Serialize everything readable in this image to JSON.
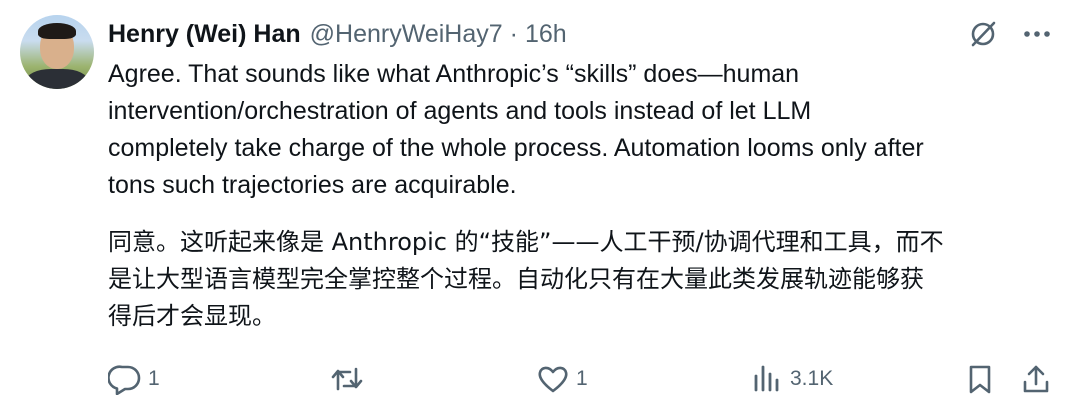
{
  "tweet": {
    "author_name": "Henry (Wei) Han",
    "handle": "@HenryWeiHay7",
    "separator": "·",
    "time": "16h",
    "text_en": "Agree. That sounds like what Anthropic’s “skills” does—human\nintervention/orchestration of agents and tools instead of let LLM\ncompletely take charge of the whole process. Automation looms only after\ntons such trajectories are acquirable.",
    "text_zh": "同意。这听起来像是 Anthropic 的“技能”——人工干预/协调代理和工具，而不\n是让大型语言模型完全掌控整个过程。自动化只有在大量此类发展轨迹能够获\n得后才会显现。"
  },
  "header_icons": [
    "grok-icon",
    "more-icon"
  ],
  "actions": {
    "reply_count": "1",
    "retweet_count": "",
    "like_count": "1",
    "views_count": "3.1K"
  },
  "colors": {
    "text_primary": "#0f1419",
    "text_secondary": "#536471",
    "background": "#ffffff"
  }
}
